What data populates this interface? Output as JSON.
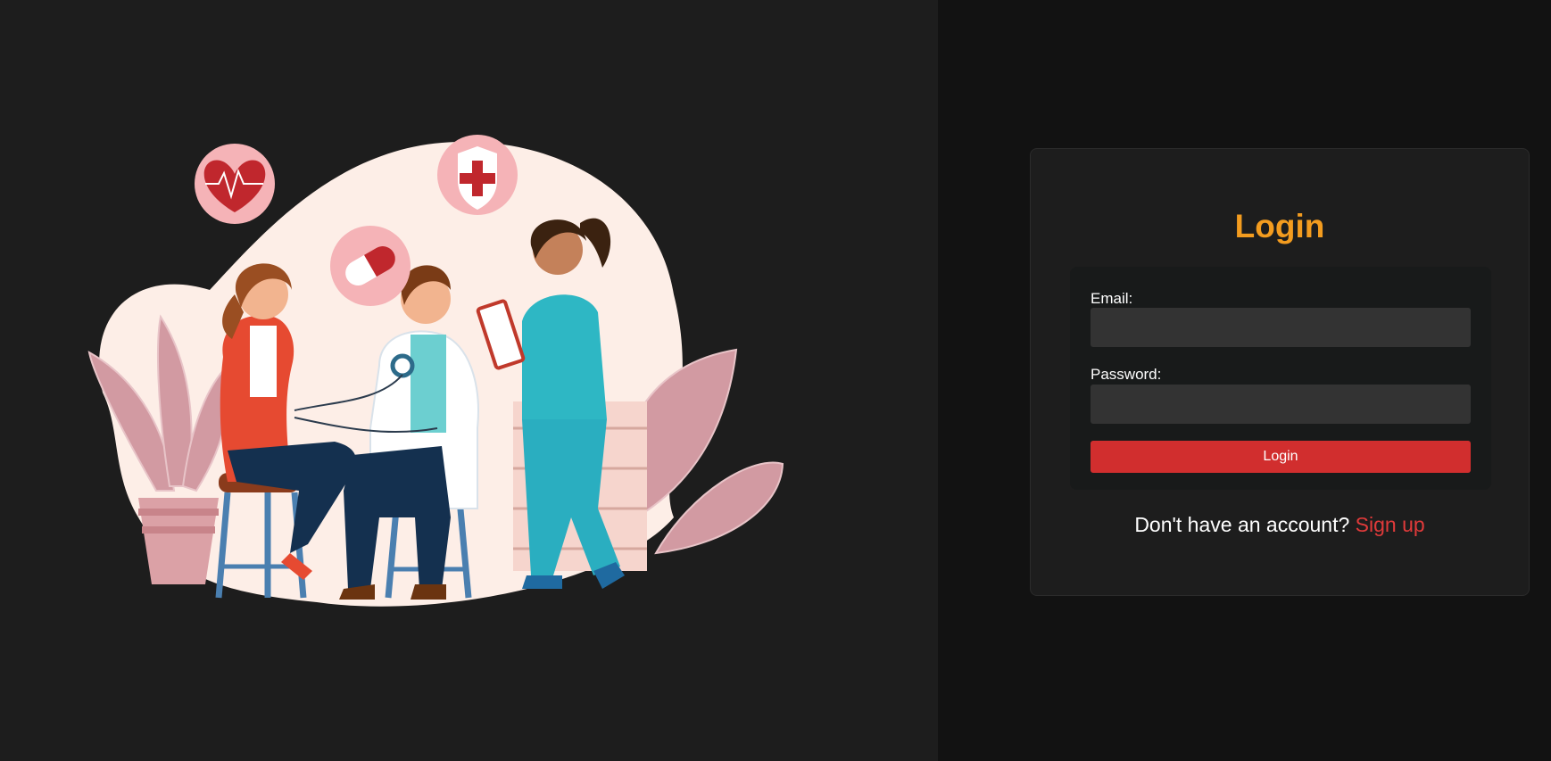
{
  "login": {
    "title": "Login",
    "email_label": "Email:",
    "email_value": "",
    "password_label": "Password:",
    "password_value": "",
    "submit_label": "Login",
    "signup_prompt": "Don't have an account?",
    "signup_link": "Sign up"
  },
  "colors": {
    "page_left_bg": "#1d1d1d",
    "page_right_bg": "#121212",
    "card_bg": "#1d1d1d",
    "title_accent": "#f39c1f",
    "button_bg": "#d12e2e",
    "link_color": "#e03a3a"
  },
  "illustration": {
    "subject": "medical-checkup-illustration",
    "icons": [
      "heartbeat-icon",
      "pill-icon",
      "medical-shield-icon"
    ]
  }
}
